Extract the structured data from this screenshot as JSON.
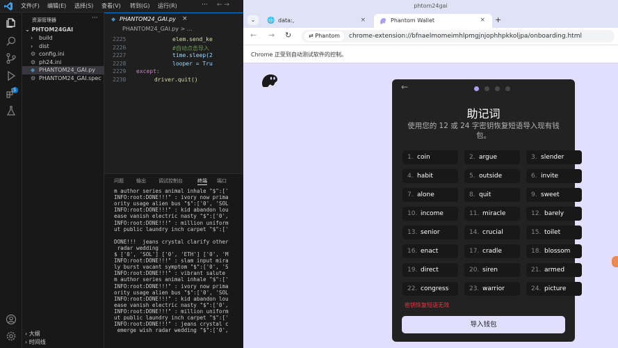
{
  "vscode": {
    "menu": [
      "文件(F)",
      "编辑(E)",
      "选择(S)",
      "查看(V)",
      "转到(G)",
      "运行(R)"
    ],
    "menu_more": "···",
    "explorer": {
      "title": "资源管理器",
      "more": "···",
      "project": "PHTOM24GAI",
      "items": [
        {
          "label": "build",
          "kind": "folder"
        },
        {
          "label": "dist",
          "kind": "folder"
        },
        {
          "label": "config.ini",
          "kind": "file"
        },
        {
          "label": "ph24.ini",
          "kind": "file"
        },
        {
          "label": "PHANTOM24_GAI.py",
          "kind": "python",
          "active": true
        },
        {
          "label": "PHANTOM24_GAI.spec",
          "kind": "file"
        }
      ],
      "outline": "大纲",
      "timeline": "时间线"
    },
    "activity_badge": "1",
    "editor": {
      "tab_label": "PHANTOM24_GAI.py",
      "tab_close": "×",
      "breadcrumb": "PHANTOM24_GAI.py > ...",
      "lines": [
        {
          "n": "2225",
          "text": "elem.send_ke",
          "indent": 8
        },
        {
          "n": "2226",
          "text": "#自动点击导入",
          "indent": 8
        },
        {
          "n": "2227",
          "text": "time.sleep(2",
          "indent": 8
        },
        {
          "n": "2228",
          "text": "looper = Tru",
          "indent": 8
        },
        {
          "n": "2229",
          "text": "except:",
          "indent": 0
        },
        {
          "n": "2230",
          "text": "driver.quit()",
          "indent": 4
        }
      ]
    },
    "panel": {
      "tabs": [
        "问题",
        "输出",
        "调试控制台",
        "终端",
        "端口"
      ],
      "active_tab": 3,
      "terminal": [
        "m author series animal inhale \"$\":['",
        "INFO:root:DONE!!!\" : ivory now prima",
        "ority usage alien bus \"$\":['0', 'SOL",
        "INFO:root:DONE!!!\" : kid abandon lou",
        "ease vanish electric nasty \"$\":['0',",
        "INFO:root:DONE!!!\" : million uniform",
        "ut public laundry inch carpet \"$\":['",
        "",
        "DONE!!!  jeans crystal clarify other",
        " radar wedding",
        "$ ['0', 'SOL'] ['0', 'ETH'] ['0', 'M",
        "INFO:root:DONE!!!\" : slam input mira",
        "ly burst vacant symptom \"$\":['0', 'S",
        "INFO:root:DONE!!!\" : vibrant salute",
        "m author series animal inhale \"$\":['",
        "INFO:root:DONE!!!\" : ivory now prima",
        "ority usage alien bus \"$\":['0', 'SOL",
        "INFO:root:DONE!!!\" : kid abandon lou",
        "ease vanish electric nasty \"$\":['0',",
        "INFO:root:DONE!!!\" : million uniform",
        "ut public laundry inch carpet \"$\":['",
        "INFO:root:DONE!!!\" : jeans crystal c",
        " emerge wish radar wedding \"$\":['0',"
      ]
    }
  },
  "chrome": {
    "window_title": "phtom24gai",
    "tab1_label": "data:,",
    "tab2_label": "Phantom Wallet",
    "close_glyph": "×",
    "new_tab_glyph": "+",
    "site_chip": "Phantom",
    "url": "chrome-extension://bfnaelmomeimhlpmgjnjophhpkkoljpa/onboarding.html",
    "infobar": "Chrome 正受到自动测试软件的控制。"
  },
  "wallet": {
    "back_glyph": "←",
    "step_dots": 4,
    "active_step": 0,
    "title": "助记词",
    "subtitle": "使用您的 12 或 24 字密钥恢复短语导入现有钱包。",
    "words": [
      {
        "num": "1.",
        "word": "coin"
      },
      {
        "num": "2.",
        "word": "argue"
      },
      {
        "num": "3.",
        "word": "slender"
      },
      {
        "num": "4.",
        "word": "habit"
      },
      {
        "num": "5.",
        "word": "outside"
      },
      {
        "num": "6.",
        "word": "invite"
      },
      {
        "num": "7.",
        "word": "alone"
      },
      {
        "num": "8.",
        "word": "quit"
      },
      {
        "num": "9.",
        "word": "sweet"
      },
      {
        "num": "10.",
        "word": "income"
      },
      {
        "num": "11.",
        "word": "miracle"
      },
      {
        "num": "12.",
        "word": "barely"
      },
      {
        "num": "13.",
        "word": "senior"
      },
      {
        "num": "14.",
        "word": "crucial"
      },
      {
        "num": "15.",
        "word": "toilet"
      },
      {
        "num": "16.",
        "word": "enact"
      },
      {
        "num": "17.",
        "word": "cradle"
      },
      {
        "num": "18.",
        "word": "blossom"
      },
      {
        "num": "19.",
        "word": "direct"
      },
      {
        "num": "20.",
        "word": "siren"
      },
      {
        "num": "21.",
        "word": "armed"
      },
      {
        "num": "22.",
        "word": "congress"
      },
      {
        "num": "23.",
        "word": "warrior"
      },
      {
        "num": "24.",
        "word": "picture"
      }
    ],
    "error": "密钥恢复短语无效",
    "import_button": "导入钱包"
  },
  "colors": {
    "vscode_bg": "#1f1f1f",
    "accent": "#0078d4",
    "page_bg": "#e2dffe",
    "card_bg": "#222222",
    "word_bg": "#181818",
    "error": "#eb3742"
  }
}
